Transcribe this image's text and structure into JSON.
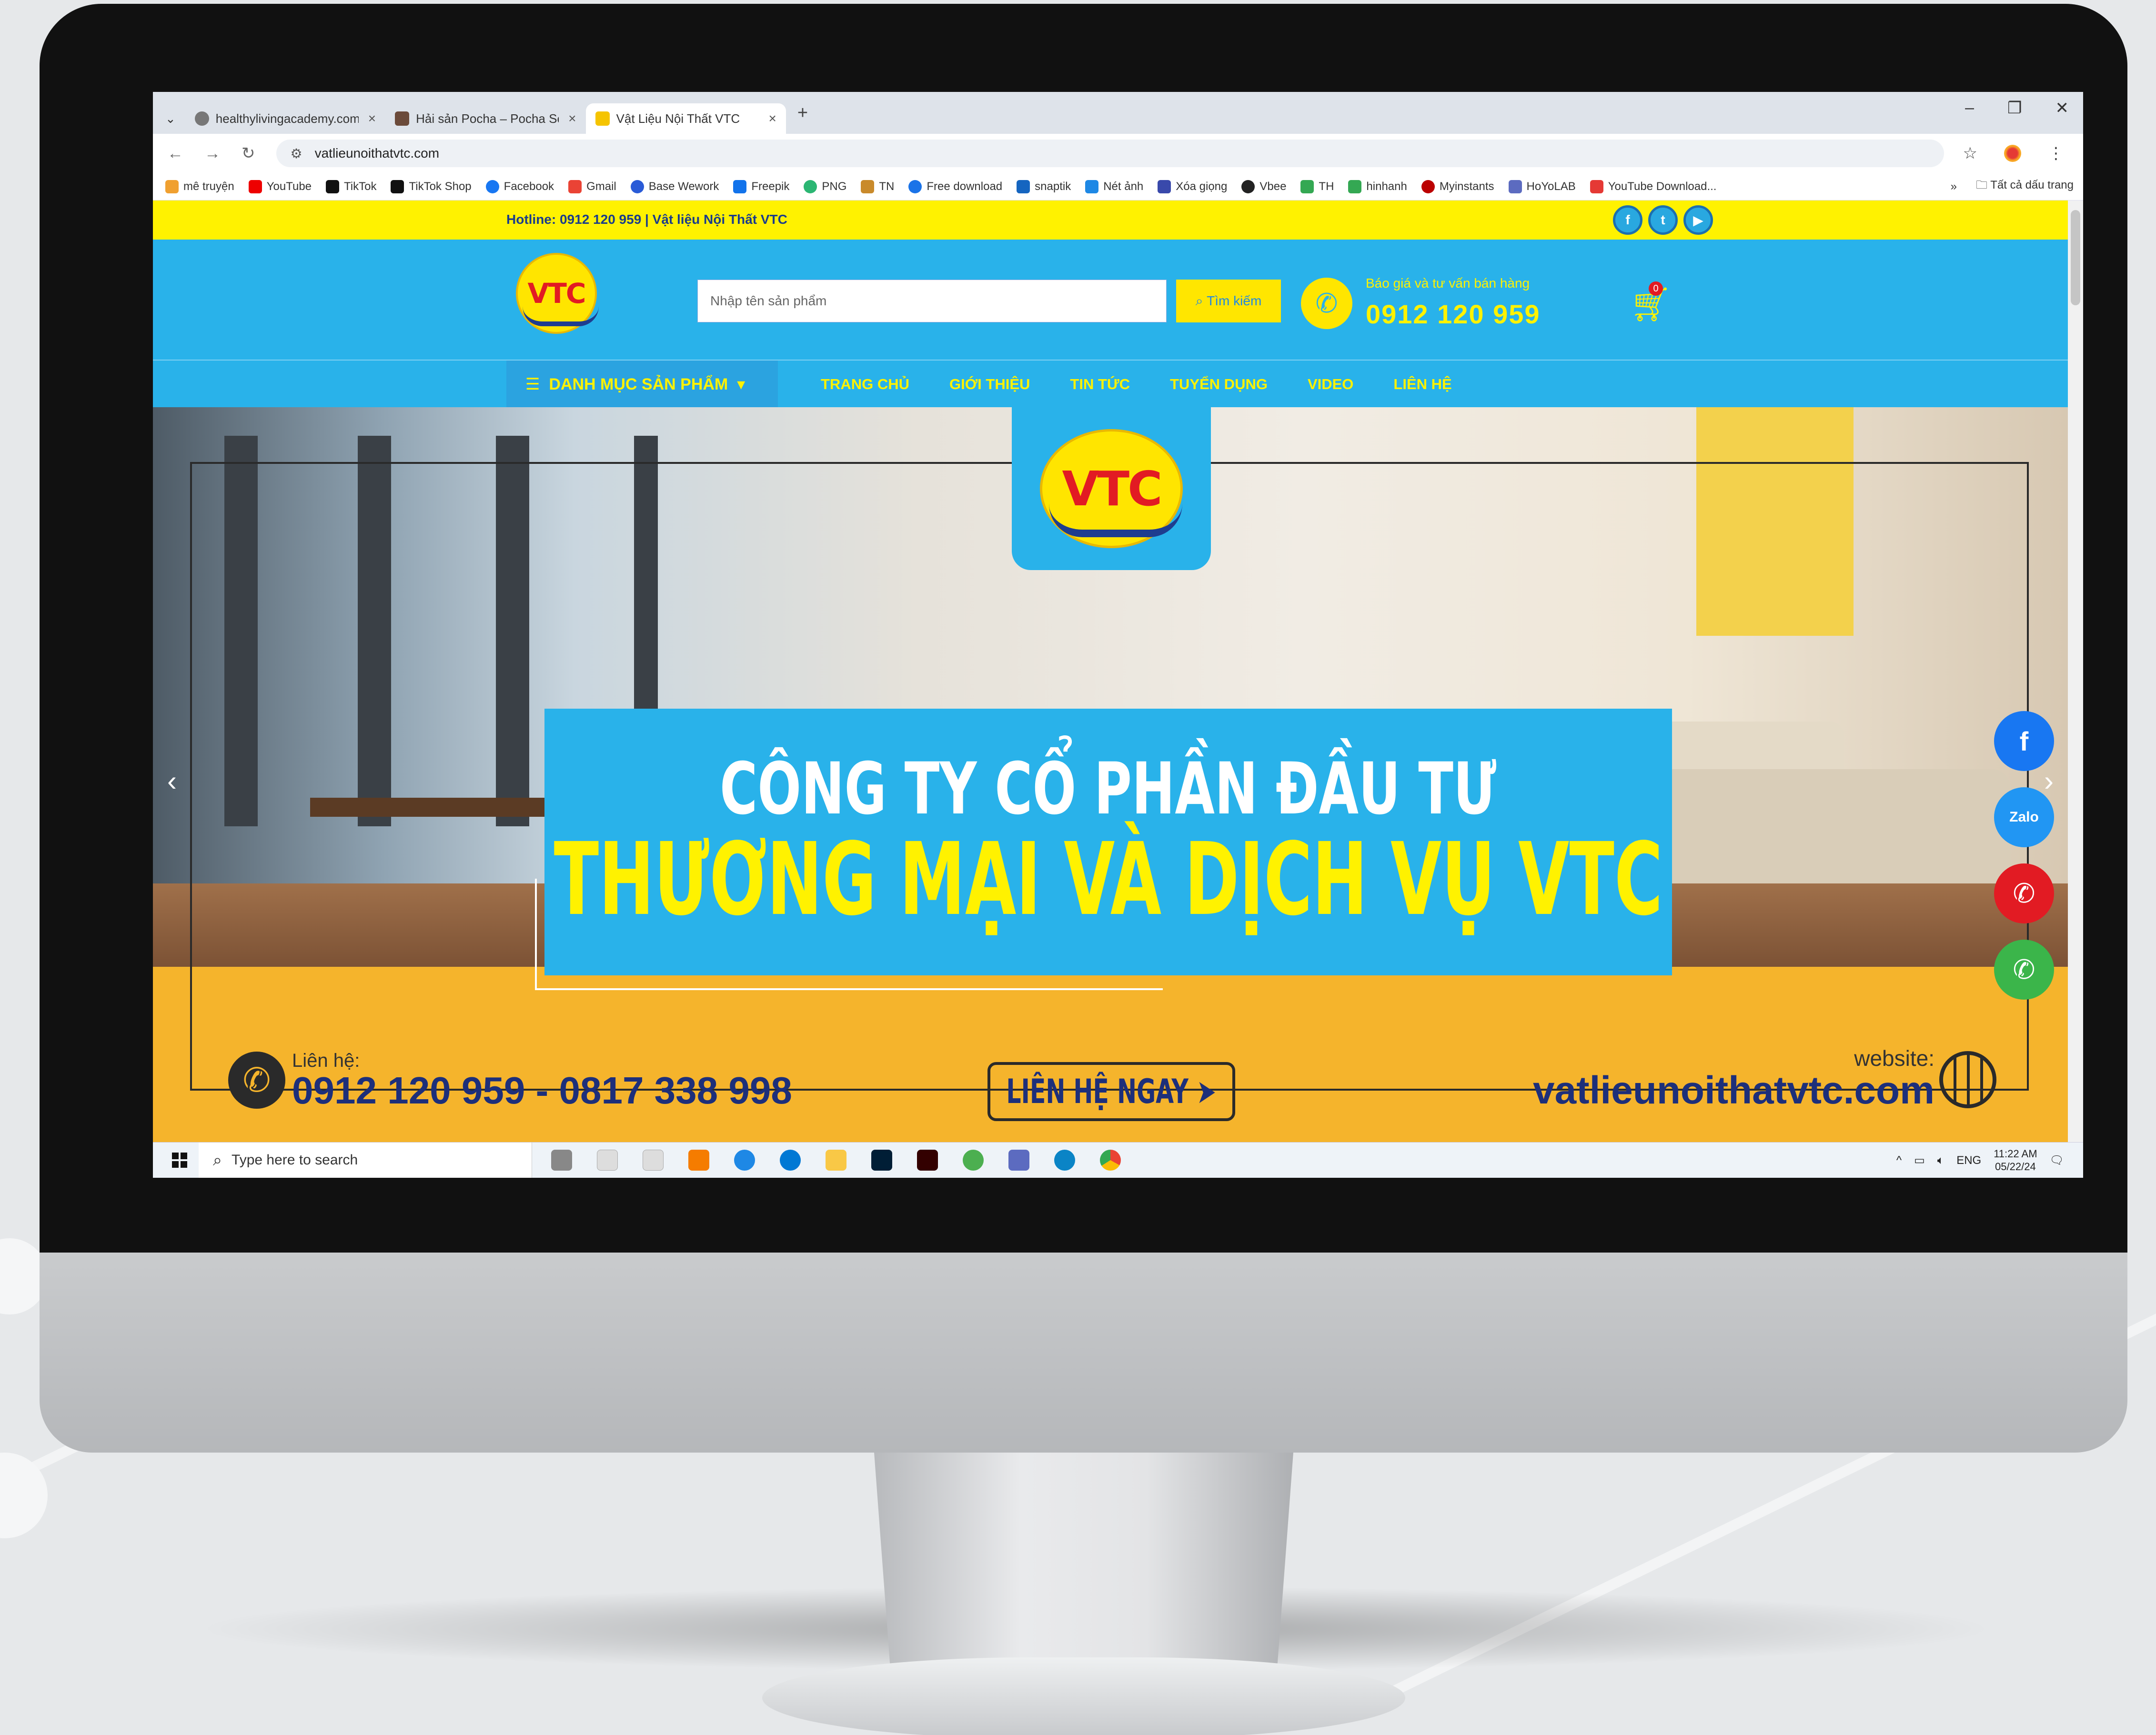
{
  "browser": {
    "tabs": [
      {
        "title": "healthylivingacademy.com",
        "active": false
      },
      {
        "title": "Hải sản Pocha – Pocha Seafood",
        "active": false
      },
      {
        "title": "Vật Liệu Nội Thất VTC",
        "active": true
      }
    ],
    "new_tab": "+",
    "url": "vatlieunoithatvtc.com",
    "bookmarks": [
      "mê truyện",
      "YouTube",
      "TikTok",
      "TikTok Shop",
      "Facebook",
      "Gmail",
      "Base Wework",
      "Freepik",
      "PNG",
      "TN",
      "Free download",
      "snaptik",
      "Nét ảnh",
      "Xóa giọng",
      "Vbee",
      "TH",
      "hinhanh",
      "Myinstants",
      "HoYoLAB",
      "YouTube Download..."
    ],
    "bookmarks_more": "»",
    "all_bookmarks": "Tất cả dấu trang"
  },
  "site": {
    "hotline": "Hotline: 0912 120 959  |  Vật liệu Nội Thất VTC",
    "logo_text": "VTC",
    "search_placeholder": "Nhập tên sản phẩm",
    "search_button": "Tìm kiếm",
    "quote_label": "Báo giá và tư vấn bán hàng",
    "phone": "0912 120 959",
    "cart_count": "0",
    "category_button": "DANH MỤC SẢN PHẨM",
    "nav": [
      "TRANG CHỦ",
      "GIỚI THIỆU",
      "TIN TỨC",
      "TUYỂN DỤNG",
      "VIDEO",
      "LIÊN HỆ"
    ]
  },
  "hero": {
    "line1": "CÔNG TY CỔ PHẦN ĐẦU TƯ",
    "line2": "THƯƠNG MẠI VÀ DỊCH VỤ VTC",
    "contact_label": "Liên hệ:",
    "contact_numbers": "0912 120 959 - 0817 338 998",
    "cta": "LIÊN HỆ NGAY",
    "website_label": "website:",
    "website_url": "vatlieunoithatvtc.com"
  },
  "taskbar": {
    "search_placeholder": "Type here to search",
    "language": "ENG",
    "time": "11:22 AM",
    "date": "05/22/24"
  },
  "colors": {
    "site_blue": "#29b2ea",
    "site_yellow": "#fff200",
    "hero_orange": "#f5b42c",
    "logo_red": "#e21b23",
    "navy": "#1d2f7a"
  }
}
